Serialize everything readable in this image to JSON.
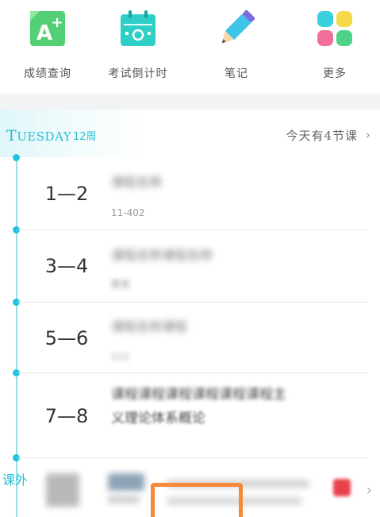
{
  "shortcuts": [
    {
      "label": "成绩查询",
      "icon": "grade-icon",
      "color": "#53d076"
    },
    {
      "label": "考试倒计时",
      "icon": "calendar-icon",
      "color": "#2ecfc6"
    },
    {
      "label": "笔记",
      "icon": "pencil-icon",
      "color": "#3fc3e8"
    },
    {
      "label": "更多",
      "icon": "more-grid-icon",
      "color": "#39d1de"
    }
  ],
  "day": {
    "name_first": "T",
    "name_rest": "UESDAY",
    "week": "12周",
    "today_count": "今天有4节课"
  },
  "schedule": [
    {
      "period": "1—2",
      "course": "课程名称",
      "room": "11-402"
    },
    {
      "period": "3—4",
      "course": "课程名称课程名称",
      "room": "教室"
    },
    {
      "period": "5—6",
      "course": "课程名称课程",
      "room": "112"
    },
    {
      "period": "7—8",
      "course_line1": "课程课程课程课程课程课程主",
      "course_line2": "义理论体系概论"
    }
  ],
  "extra": {
    "label": "课外"
  },
  "colors": {
    "accent": "#26bfd6",
    "highlight_box": "#f5893a"
  }
}
